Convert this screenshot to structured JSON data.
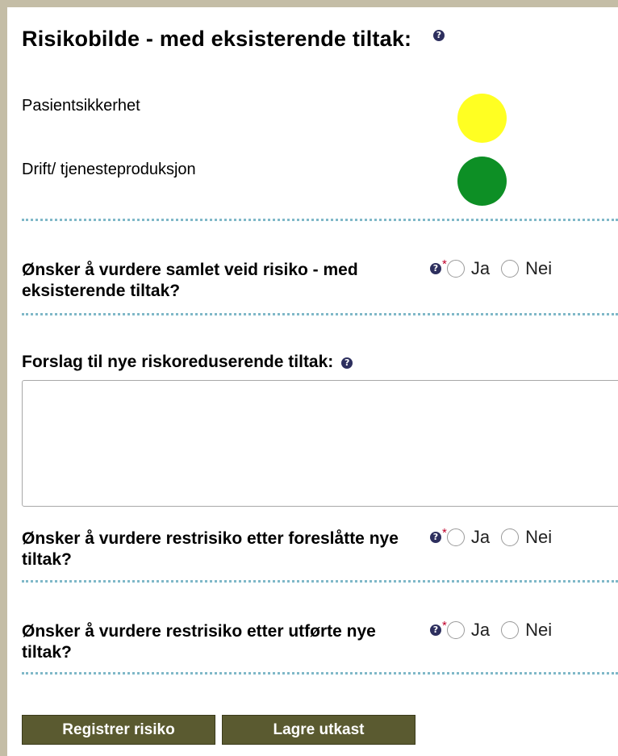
{
  "title": "Risikobilde - med eksisterende tiltak:",
  "help_icon": "?",
  "risk_rows": [
    {
      "label": "Pasientsikkerhet",
      "color": "#ffff22"
    },
    {
      "label": "Drift/ tjenesteproduksjon",
      "color": "#0d8f25"
    }
  ],
  "required_marker": "*",
  "questions": [
    {
      "label": "Ønsker å vurdere samlet veid risiko - med eksisterende tiltak?",
      "yes": "Ja",
      "no": "Nei"
    },
    {
      "label": "Ønsker å vurdere restrisiko etter foreslåtte nye tiltak?",
      "yes": "Ja",
      "no": "Nei"
    },
    {
      "label": "Ønsker å vurdere restrisiko etter utførte nye tiltak?",
      "yes": "Ja",
      "no": "Nei"
    }
  ],
  "proposal": {
    "label": "Forslag til nye riskoreduserende tiltak:",
    "value": ""
  },
  "buttons": {
    "register": "Registrer risiko",
    "save_draft": "Lagre utkast"
  },
  "colors": {
    "frame": "#c4bda6",
    "button": "#5a5a30",
    "divider": "#7fb8c8",
    "help": "#2d2f5e",
    "required": "#c0002a"
  }
}
